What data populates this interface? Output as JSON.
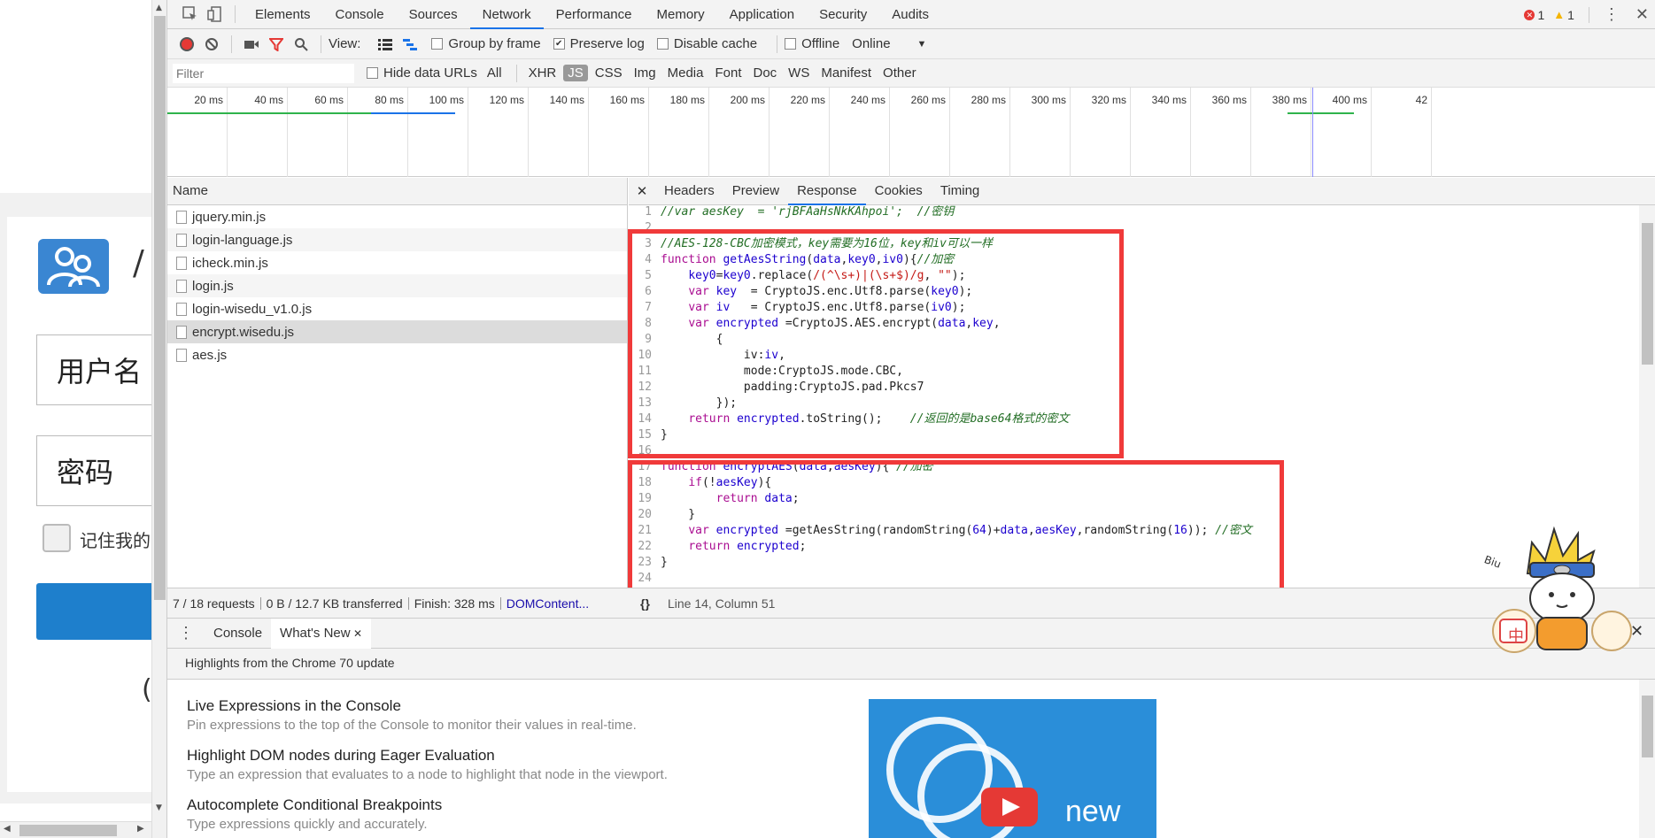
{
  "left_page": {
    "username_label": "用户名",
    "password_label": "密码",
    "remember_label": "记住我的",
    "partial_title": "/",
    "partial_bottom": "("
  },
  "devtools": {
    "tabs": [
      "Elements",
      "Console",
      "Sources",
      "Network",
      "Performance",
      "Memory",
      "Application",
      "Security",
      "Audits"
    ],
    "active_tab": "Network",
    "errors": "1",
    "warnings": "1",
    "toolbar": {
      "view_label": "View:",
      "group_by_frame": "Group by frame",
      "preserve_log": "Preserve log",
      "disable_cache": "Disable cache",
      "offline": "Offline",
      "throttle": "Online"
    },
    "filterbar": {
      "placeholder": "Filter",
      "hide_data_urls": "Hide data URLs",
      "types": [
        "All",
        "XHR",
        "JS",
        "CSS",
        "Img",
        "Media",
        "Font",
        "Doc",
        "WS",
        "Manifest",
        "Other"
      ],
      "active_type": "JS"
    },
    "timeline_ticks": [
      "20 ms",
      "40 ms",
      "60 ms",
      "80 ms",
      "100 ms",
      "120 ms",
      "140 ms",
      "160 ms",
      "180 ms",
      "200 ms",
      "220 ms",
      "240 ms",
      "260 ms",
      "280 ms",
      "300 ms",
      "320 ms",
      "340 ms",
      "360 ms",
      "380 ms",
      "400 ms",
      "42"
    ],
    "name_header": "Name",
    "requests": [
      "jquery.min.js",
      "login-language.js",
      "icheck.min.js",
      "login.js",
      "login-wisedu_v1.0.js",
      "encrypt.wisedu.js",
      "aes.js"
    ],
    "selected_request": "encrypt.wisedu.js",
    "detail_tabs": [
      "Headers",
      "Preview",
      "Response",
      "Cookies",
      "Timing"
    ],
    "active_detail_tab": "Response",
    "code_lines": [
      {
        "n": "1",
        "segs": [
          [
            "c",
            "//var aesKey  = 'rjBFAaHsNkKAhpoi';  //密钥"
          ]
        ]
      },
      {
        "n": "2",
        "segs": []
      },
      {
        "n": "3",
        "segs": [
          [
            "c",
            "//AES-128-CBC加密模式，key需要为16位，key和iv可以一样"
          ]
        ]
      },
      {
        "n": "4",
        "segs": [
          [
            "k",
            "function "
          ],
          [
            "f",
            "getAesString"
          ],
          [
            "t",
            "("
          ],
          [
            "f",
            "data"
          ],
          [
            "t",
            ","
          ],
          [
            "f",
            "key0"
          ],
          [
            "t",
            ","
          ],
          [
            "f",
            "iv0"
          ],
          [
            "t",
            "){"
          ],
          [
            "c",
            "//加密"
          ]
        ]
      },
      {
        "n": "5",
        "segs": [
          [
            "t",
            "    "
          ],
          [
            "f",
            "key0"
          ],
          [
            "t",
            "="
          ],
          [
            "f",
            "key0"
          ],
          [
            "t",
            ".replace("
          ],
          [
            "s",
            "/(^\\s+)|(\\s+$)/g"
          ],
          [
            "t",
            ", "
          ],
          [
            "s",
            "\"\""
          ],
          [
            "t",
            ");"
          ]
        ]
      },
      {
        "n": "6",
        "segs": [
          [
            "t",
            "    "
          ],
          [
            "k",
            "var "
          ],
          [
            "f",
            "key"
          ],
          [
            "t",
            "  = CryptoJS.enc.Utf8.parse("
          ],
          [
            "f",
            "key0"
          ],
          [
            "t",
            ");"
          ]
        ]
      },
      {
        "n": "7",
        "segs": [
          [
            "t",
            "    "
          ],
          [
            "k",
            "var "
          ],
          [
            "f",
            "iv"
          ],
          [
            "t",
            "   = CryptoJS.enc.Utf8.parse("
          ],
          [
            "f",
            "iv0"
          ],
          [
            "t",
            ");"
          ]
        ]
      },
      {
        "n": "8",
        "segs": [
          [
            "t",
            "    "
          ],
          [
            "k",
            "var "
          ],
          [
            "f",
            "encrypted"
          ],
          [
            "t",
            " =CryptoJS.AES.encrypt("
          ],
          [
            "f",
            "data"
          ],
          [
            "t",
            ","
          ],
          [
            "f",
            "key"
          ],
          [
            "t",
            ","
          ]
        ]
      },
      {
        "n": "9",
        "segs": [
          [
            "t",
            "        {"
          ]
        ]
      },
      {
        "n": "10",
        "segs": [
          [
            "t",
            "            iv:"
          ],
          [
            "f",
            "iv"
          ],
          [
            "t",
            ","
          ]
        ]
      },
      {
        "n": "11",
        "segs": [
          [
            "t",
            "            mode:CryptoJS.mode.CBC,"
          ]
        ]
      },
      {
        "n": "12",
        "segs": [
          [
            "t",
            "            padding:CryptoJS.pad.Pkcs7"
          ]
        ]
      },
      {
        "n": "13",
        "segs": [
          [
            "t",
            "        });"
          ]
        ]
      },
      {
        "n": "14",
        "segs": [
          [
            "t",
            "    "
          ],
          [
            "k",
            "return "
          ],
          [
            "f",
            "encrypted"
          ],
          [
            "t",
            ".toString();    "
          ],
          [
            "c",
            "//返回的是base64格式的密文"
          ]
        ]
      },
      {
        "n": "15",
        "segs": [
          [
            "t",
            "}"
          ]
        ]
      },
      {
        "n": "16",
        "segs": []
      },
      {
        "n": "17",
        "segs": [
          [
            "k",
            "function "
          ],
          [
            "f",
            "encryptAES"
          ],
          [
            "t",
            "("
          ],
          [
            "f",
            "data"
          ],
          [
            "t",
            ","
          ],
          [
            "f",
            "aesKey"
          ],
          [
            "t",
            "){ "
          ],
          [
            "c",
            "//加密"
          ]
        ]
      },
      {
        "n": "18",
        "segs": [
          [
            "t",
            "    "
          ],
          [
            "k",
            "if"
          ],
          [
            "t",
            "(!"
          ],
          [
            "f",
            "aesKey"
          ],
          [
            "t",
            "){"
          ]
        ]
      },
      {
        "n": "19",
        "segs": [
          [
            "t",
            "        "
          ],
          [
            "k",
            "return "
          ],
          [
            "f",
            "data"
          ],
          [
            "t",
            ";"
          ]
        ]
      },
      {
        "n": "20",
        "segs": [
          [
            "t",
            "    }"
          ]
        ]
      },
      {
        "n": "21",
        "segs": [
          [
            "t",
            "    "
          ],
          [
            "k",
            "var "
          ],
          [
            "f",
            "encrypted"
          ],
          [
            "t",
            " =getAesString(randomString("
          ],
          [
            "f",
            "64"
          ],
          [
            "t",
            ")+"
          ],
          [
            "f",
            "data"
          ],
          [
            "t",
            ","
          ],
          [
            "f",
            "aesKey"
          ],
          [
            "t",
            ",randomString("
          ],
          [
            "f",
            "16"
          ],
          [
            "t",
            ")); "
          ],
          [
            "c",
            "//密文"
          ]
        ]
      },
      {
        "n": "22",
        "segs": [
          [
            "t",
            "    "
          ],
          [
            "k",
            "return "
          ],
          [
            "f",
            "encrypted"
          ],
          [
            "t",
            ";"
          ]
        ]
      },
      {
        "n": "23",
        "segs": [
          [
            "t",
            "}"
          ]
        ]
      },
      {
        "n": "24",
        "segs": []
      }
    ],
    "status": {
      "requests": "7 / 18 requests",
      "transferred": "0 B / 12.7 KB transferred",
      "finish": "Finish: 328 ms",
      "domcontent": "DOMContent...",
      "pretty": "{}",
      "cursor": "Line 14, Column 51"
    },
    "drawer": {
      "tabs": [
        "Console",
        "What's New"
      ],
      "active": "What's New",
      "subhead": "Highlights from the Chrome 70 update",
      "items": [
        {
          "title": "Live Expressions in the Console",
          "desc": "Pin expressions to the top of the Console to monitor their values in real-time."
        },
        {
          "title": "Highlight DOM nodes during Eager Evaluation",
          "desc": "Type an expression that evaluates to a node to highlight that node in the viewport."
        },
        {
          "title": "Autocomplete Conditional Breakpoints",
          "desc": "Type expressions quickly and accurately."
        }
      ],
      "video_text": "new"
    },
    "sticker_text": "中",
    "sticker_biu": "Biu"
  },
  "colors": {
    "highlight_box": "#f03a3a",
    "active_tab_underline": "#1a73e8",
    "record": "#e53935"
  }
}
